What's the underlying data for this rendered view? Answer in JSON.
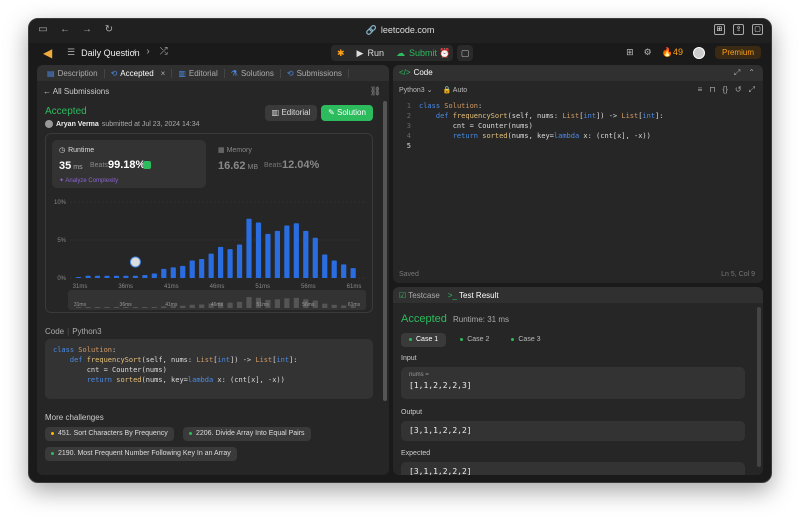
{
  "browser": {
    "url": "leetcode.com"
  },
  "header": {
    "title": "Daily Question",
    "run_label": "Run",
    "submit_label": "Submit",
    "streak": "49",
    "premium_label": "Premium"
  },
  "left_tabs": [
    {
      "label": "Description"
    },
    {
      "label": "Accepted"
    },
    {
      "label": "Editorial"
    },
    {
      "label": "Solutions"
    },
    {
      "label": "Submissions"
    }
  ],
  "submission": {
    "back_label": "All Submissions",
    "status": "Accepted",
    "user": "Aryan Verma",
    "submitted_text": "submitted at Jul 23, 2024 14:34",
    "editorial_btn": "Editorial",
    "solution_btn": "Solution"
  },
  "runtime": {
    "title": "Runtime",
    "value": "35",
    "unit": "ms",
    "beats_label": "Beats",
    "beats": "99.18%",
    "analyze": "Analyze Complexity"
  },
  "memory": {
    "title": "Memory",
    "value": "16.62",
    "unit": "MB",
    "beats_label": "Beats",
    "beats": "12.04%"
  },
  "chart_data": {
    "type": "bar",
    "ylim": [
      0,
      10
    ],
    "y_ticks": [
      "10%",
      "5%",
      "0%"
    ],
    "y_tick_values": [
      10,
      5,
      0
    ],
    "x_ticks": [
      "31ms",
      "36ms",
      "41ms",
      "46ms",
      "51ms",
      "56ms",
      "61ms"
    ],
    "values": [
      0.1,
      0.3,
      0.3,
      0.3,
      0.3,
      0.3,
      0.3,
      0.4,
      0.6,
      1.2,
      1.4,
      1.6,
      2.3,
      2.5,
      3.2,
      4.1,
      3.8,
      4.4,
      7.8,
      7.3,
      5.8,
      6.2,
      6.9,
      7.2,
      6.2,
      5.3,
      3.1,
      2.3,
      1.8,
      1.3
    ]
  },
  "minimap_ticks": [
    "31ms",
    "36ms",
    "41ms",
    "46ms",
    "51ms",
    "56ms",
    "61ms"
  ],
  "code_section": {
    "label": "Code",
    "lang": "Python3",
    "lines": [
      "class Solution:",
      "    def frequencySort(self, nums: List[int]) -> List[int]:",
      "        cnt = Counter(nums)",
      "        return sorted(nums, key=lambda x: (cnt[x], -x))"
    ]
  },
  "more_challenges": {
    "title": "More challenges",
    "items": [
      {
        "label": "451. Sort Characters By Frequency",
        "color": "#ffb800"
      },
      {
        "label": "2206. Divide Array Into Equal Pairs",
        "color": "#2cbb5d"
      },
      {
        "label": "2190. Most Frequent Number Following Key In an Array",
        "color": "#2cbb5d"
      }
    ]
  },
  "editor": {
    "tab_label": "Code",
    "language": "Python3",
    "mode": "Auto",
    "line_numbers": [
      "1",
      "2",
      "3",
      "4",
      "5"
    ],
    "saved": "Saved",
    "cursor": "Ln 5, Col 9"
  },
  "test": {
    "tab_testcase": "Testcase",
    "tab_result": "Test Result",
    "status": "Accepted",
    "runtime": "Runtime: 31 ms",
    "cases": [
      "Case 1",
      "Case 2",
      "Case 3"
    ],
    "input_label": "Input",
    "input_var": "nums =",
    "input_value": "[1,1,2,2,2,3]",
    "output_label": "Output",
    "output_value": "[3,1,1,2,2,2]",
    "expected_label": "Expected",
    "expected_value": "[3,1,1,2,2,2]"
  },
  "colors": {
    "accent_green": "#2cbb5d",
    "bar_blue": "#2a6de0",
    "premium_orange": "#ffa116"
  }
}
